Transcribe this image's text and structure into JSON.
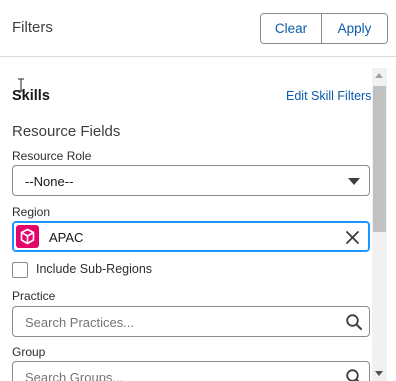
{
  "header": {
    "title": "Filters",
    "clear_label": "Clear",
    "apply_label": "Apply"
  },
  "skills": {
    "title": "Skills",
    "edit_link": "Edit Skill Filters"
  },
  "resource_fields": {
    "title": "Resource Fields",
    "resource_role": {
      "label": "Resource Role",
      "value": "--None--"
    },
    "region": {
      "label": "Region",
      "value": "APAC",
      "icon": "region-entity-icon"
    },
    "include_subregions": {
      "label": "Include Sub-Regions",
      "checked": false
    },
    "practice": {
      "label": "Practice",
      "placeholder": "Search Practices..."
    },
    "group": {
      "label": "Group",
      "placeholder": "Search Groups..."
    }
  },
  "colors": {
    "link": "#0b5cab",
    "focus": "#1b96ff",
    "entity_icon": "#e3066a"
  }
}
